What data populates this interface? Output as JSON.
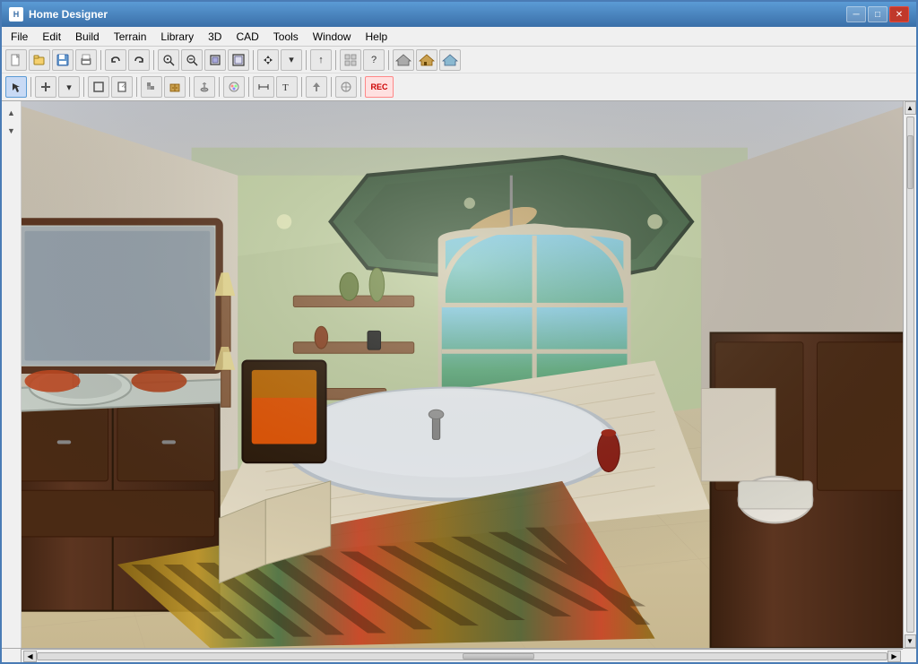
{
  "window": {
    "title": "Home Designer",
    "icon": "H"
  },
  "title_controls": {
    "minimize": "─",
    "maximize": "□",
    "close": "✕"
  },
  "menu": {
    "items": [
      "File",
      "Edit",
      "Build",
      "Terrain",
      "Library",
      "3D",
      "CAD",
      "Tools",
      "Window",
      "Help"
    ]
  },
  "toolbar1": {
    "buttons": [
      {
        "name": "new",
        "icon": "📄"
      },
      {
        "name": "open",
        "icon": "📂"
      },
      {
        "name": "save",
        "icon": "💾"
      },
      {
        "name": "print",
        "icon": "🖨"
      },
      {
        "name": "sep1",
        "icon": ""
      },
      {
        "name": "undo",
        "icon": "↩"
      },
      {
        "name": "redo",
        "icon": "↪"
      },
      {
        "name": "sep2",
        "icon": ""
      },
      {
        "name": "zoom-in",
        "icon": "🔍"
      },
      {
        "name": "zoom-out",
        "icon": "🔍"
      },
      {
        "name": "zoom-fit",
        "icon": "⊞"
      },
      {
        "name": "zoom-all",
        "icon": "⊠"
      },
      {
        "name": "sep3",
        "icon": ""
      },
      {
        "name": "select",
        "icon": "⊹"
      },
      {
        "name": "pan",
        "icon": "✥"
      },
      {
        "name": "sep4",
        "icon": ""
      },
      {
        "name": "orbit",
        "icon": "↻"
      },
      {
        "name": "sep5",
        "icon": ""
      },
      {
        "name": "camera",
        "icon": "📷"
      },
      {
        "name": "help",
        "icon": "?"
      },
      {
        "name": "sep6",
        "icon": ""
      },
      {
        "name": "house1",
        "icon": "🏠"
      },
      {
        "name": "house2",
        "icon": "🏠"
      },
      {
        "name": "house3",
        "icon": "🏠"
      }
    ]
  },
  "toolbar2": {
    "buttons": [
      {
        "name": "select-tool",
        "icon": "↖"
      },
      {
        "name": "sep1",
        "icon": ""
      },
      {
        "name": "wall-tool",
        "icon": "⊢"
      },
      {
        "name": "sep2",
        "icon": ""
      },
      {
        "name": "door-tool",
        "icon": "▭"
      },
      {
        "name": "window-tool",
        "icon": "▣"
      },
      {
        "name": "sep3",
        "icon": ""
      },
      {
        "name": "stair-tool",
        "icon": "≡"
      },
      {
        "name": "room-tool",
        "icon": "□"
      },
      {
        "name": "sep4",
        "icon": ""
      },
      {
        "name": "cabinet-tool",
        "icon": "▤"
      },
      {
        "name": "sep5",
        "icon": ""
      },
      {
        "name": "fixture-tool",
        "icon": "⊕"
      },
      {
        "name": "sep6",
        "icon": ""
      },
      {
        "name": "material-tool",
        "icon": "🎨"
      },
      {
        "name": "sep7",
        "icon": ""
      },
      {
        "name": "measure-tool",
        "icon": "📏"
      },
      {
        "name": "sep8",
        "icon": ""
      },
      {
        "name": "text-tool",
        "icon": "T"
      },
      {
        "name": "sep9",
        "icon": ""
      },
      {
        "name": "arrow-tool",
        "icon": "↑"
      },
      {
        "name": "sep10",
        "icon": ""
      },
      {
        "name": "rec-tool",
        "icon": "REC"
      }
    ]
  },
  "viewport": {
    "description": "3D bathroom interior render"
  },
  "colors": {
    "title_bar_start": "#5b9bd5",
    "title_bar_end": "#3a6fa8",
    "window_border": "#4a7cb5",
    "menu_bg": "#f0f0f0",
    "toolbar_bg": "#f0f0f0",
    "accent": "#5b9bd5"
  }
}
